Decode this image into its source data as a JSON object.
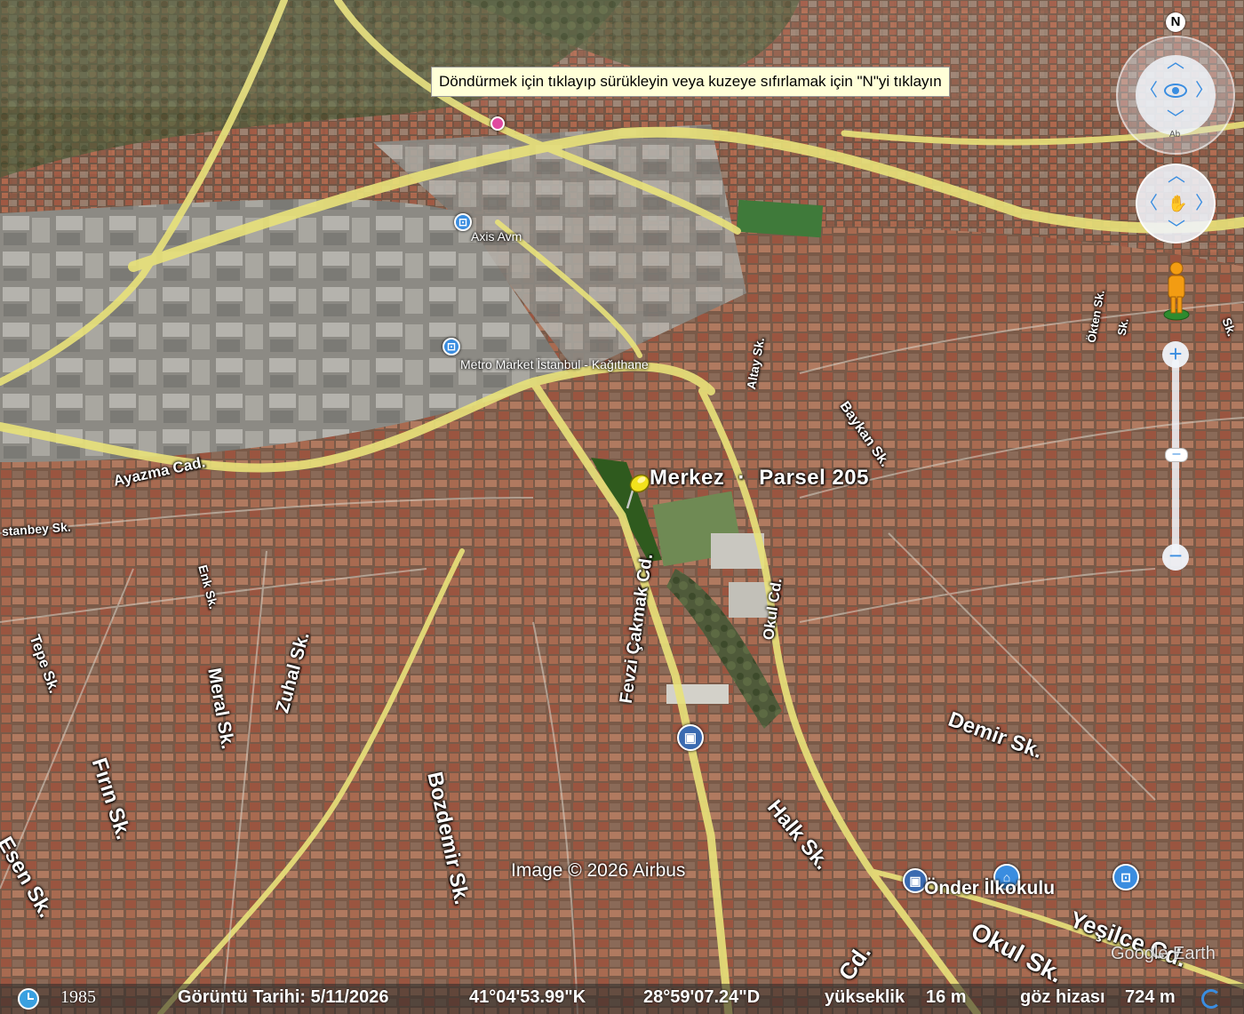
{
  "tooltip": "Döndürmek için tıklayıp sürükleyin veya kuzeye sıfırlamak için \"N\"yi tıklayın",
  "placemark": {
    "name": "Merkez",
    "separator": "·",
    "parcel": "Parsel 205"
  },
  "pois": {
    "axis": "Axis Avm",
    "metro": "Metro Market İstanbul - Kağıthane",
    "onder": "Önder İlkokulu"
  },
  "streets": {
    "ayazma": "Ayazma Cad.",
    "stanbey": "stanbey Sk.",
    "fevzi": "Fevzi Çakmak Cd.",
    "okul_cd": "Okul Cd.",
    "altay": "Altay Sk.",
    "baykan": "Baykan Sk.",
    "okten": "Ökten Sk.",
    "tepe": "Tepe Sk.",
    "meral": "Meral Sk.",
    "zuhal": "Zuhal Sk.",
    "firin": "Fırın Sk.",
    "esen": "Esen Sk.",
    "bozdemir": "Bozdemir Sk.",
    "demir": "Demir Sk.",
    "halk": "Halk Sk.",
    "okul_sk": "Okul Sk.",
    "yesilce": "Yeşilce Cd.",
    "cd_bottom": "Cd.",
    "sk_right": "Sk.",
    "sk_top": "Sk.",
    "enk": "Enk Sk."
  },
  "copyright": "Image © 2026 Airbus",
  "logo": "Google Earth",
  "nav": {
    "north": "N",
    "tilt_hint": "Ab"
  },
  "statusbar": {
    "year": "1985",
    "imagery_date": "Görüntü Tarihi: 5/11/2026",
    "lat": "41°04'53.99\"K",
    "lon": "28°59'07.24\"D",
    "elev_label": "yükseklik",
    "elev": "16 m",
    "eye_label": "göz hizası",
    "eye": "724 m"
  },
  "colors": {
    "road": "#e9e27a",
    "accent": "#3a8de0",
    "pin": "#f2e21c"
  }
}
